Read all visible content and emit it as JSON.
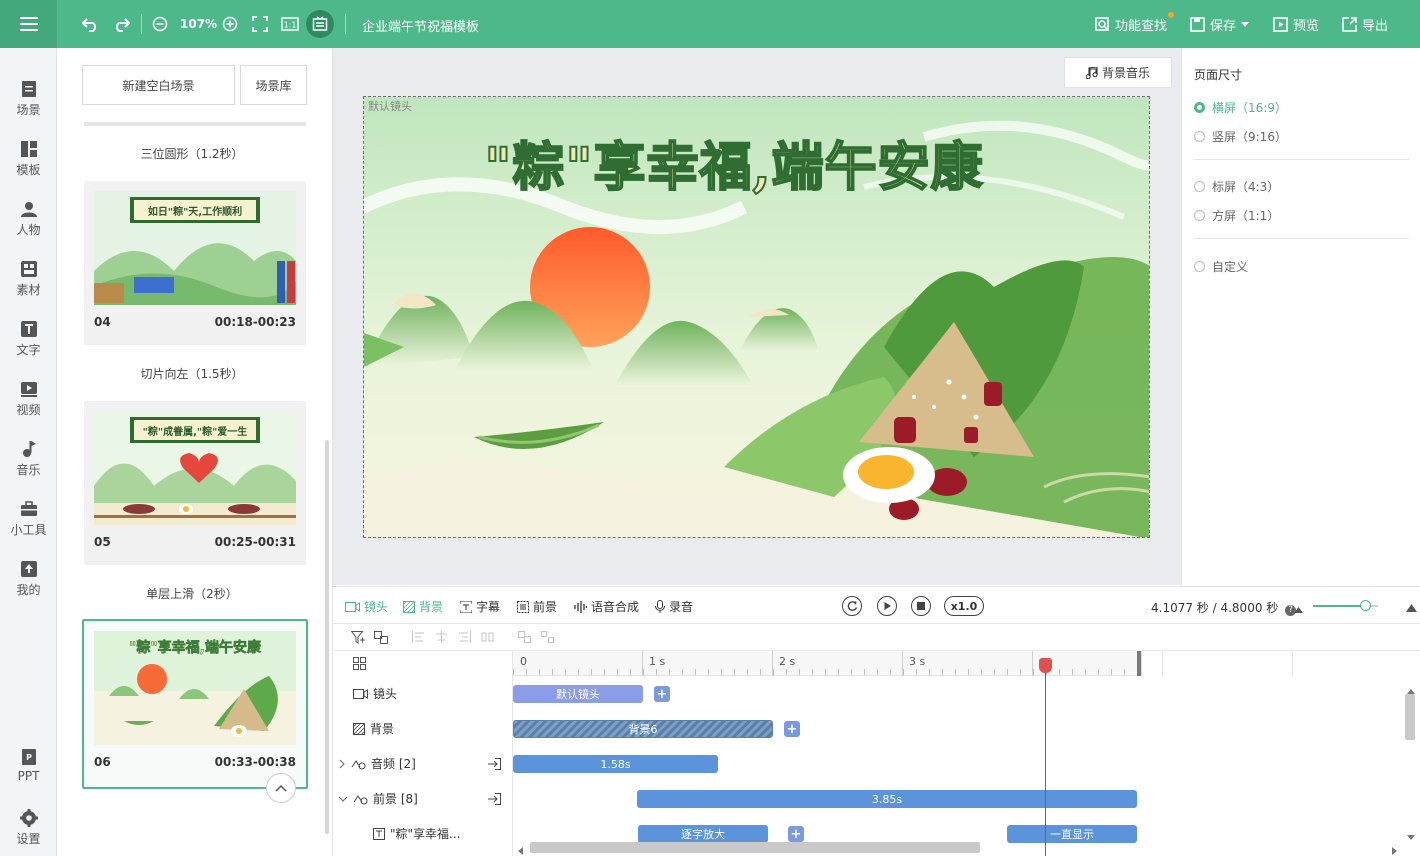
{
  "topbar": {
    "zoom": "107%",
    "title": "企业端午节祝福模板",
    "find_label": "功能查找",
    "save_label": "保存",
    "preview_label": "预览",
    "export_label": "导出"
  },
  "nav": {
    "items": [
      {
        "label": "场景",
        "icon": "scene-icon"
      },
      {
        "label": "模板",
        "icon": "template-icon"
      },
      {
        "label": "人物",
        "icon": "person-icon"
      },
      {
        "label": "素材",
        "icon": "material-icon"
      },
      {
        "label": "文字",
        "icon": "text-icon"
      },
      {
        "label": "视频",
        "icon": "video-icon"
      },
      {
        "label": "音乐",
        "icon": "music-icon"
      },
      {
        "label": "小工具",
        "icon": "toolbox-icon"
      },
      {
        "label": "我的",
        "icon": "upload-icon"
      }
    ],
    "ppt_label": "PPT",
    "settings_label": "设置"
  },
  "scenes": {
    "new_blank_label": "新建空白场景",
    "library_label": "场景库",
    "transitions": [
      "三位圆形（1.2秒）",
      "切片向左（1.5秒）",
      "单层上滑（2秒）"
    ],
    "cards": [
      {
        "num": "04",
        "time": "00:18-00:23",
        "banner": "如日\"粽\"天,工作顺利"
      },
      {
        "num": "05",
        "time": "00:25-00:31",
        "banner": "\"粽\"成眷属,\"粽\"爱一生"
      },
      {
        "num": "06",
        "time": "00:33-00:38",
        "banner": "\"粽\"享幸福,端午安康"
      }
    ]
  },
  "canvas": {
    "bgm_label": "背景音乐",
    "lens_label": "默认镜头",
    "title": "\"粽\"享幸福,端午安康"
  },
  "right_panel": {
    "title": "页面尺寸",
    "options": [
      {
        "label": "横屏（16:9）",
        "selected": true
      },
      {
        "label": "竖屏（9:16）",
        "selected": false
      },
      {
        "label": "标屏（4:3）",
        "selected": false
      },
      {
        "label": "方屏（1:1）",
        "selected": false
      },
      {
        "label": "自定义",
        "selected": false
      }
    ]
  },
  "timeline": {
    "tabs": [
      "镜头",
      "背景",
      "字幕",
      "前景",
      "语音合成",
      "录音"
    ],
    "speed": "x1.0",
    "time_info": "4.1077 秒 / 4.8000 秒",
    "ruler": [
      "0",
      "1 s",
      "2 s",
      "3 s"
    ],
    "tracks": [
      {
        "label": "镜头"
      },
      {
        "label": "背景"
      },
      {
        "label": "音频 [2]"
      },
      {
        "label": "前景 [8]"
      },
      {
        "label": "\"粽\"享幸福..."
      }
    ],
    "clips": {
      "lens": "默认镜头",
      "background": "背景6",
      "audio": "1.58s",
      "foreground": "3.85s",
      "text_anim_1": "逐字放大",
      "text_anim_2": "一直显示"
    },
    "playhead_seconds": 4.1077,
    "total_seconds": 4.8
  },
  "colors": {
    "accent": "#4db98a",
    "topbar": "#4db98a",
    "clip_blue": "#5b94db",
    "clip_purple": "#8b9de8",
    "playhead": "#d23b3b"
  }
}
